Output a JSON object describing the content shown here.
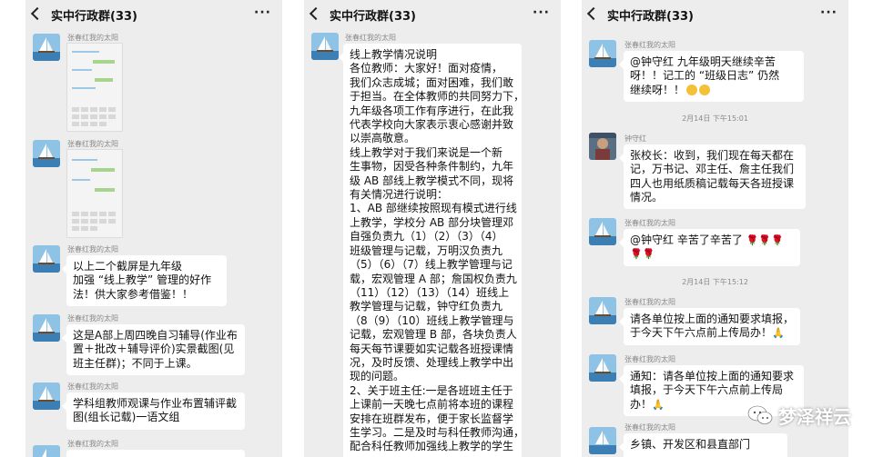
{
  "window_title": "实中行政群(33)",
  "panel1": {
    "senders": [
      "张春红我的太阳",
      "张春红我的太阳",
      "张春红我的太阳",
      "张春红我的太阳",
      "张春红我的太阳",
      "张春红我的太阳"
    ],
    "msg1": [
      "以上二个截屏是九年级",
      "加强 “线上教学” 管理的好作",
      "法！供大家参考借鉴！！"
    ],
    "msg2": [
      "这是A部上周四晚自习辅导(作业布",
      "置＋批改＋辅导评价)实景截图(见",
      "班主任群)；不同于上课。"
    ],
    "msg3": [
      "学科组教师观课与作业布置辅评截",
      "图(组长记载)一语文组"
    ]
  },
  "panel2": {
    "sender": "张春红我的太阳",
    "lines": [
      "线上教学情况说明",
      "   各位教师：大家好！面对疫情，",
      "我们众志成城；面对困难，我们敢",
      "于担当。在全体教师的共同努力下，",
      "九年级各项工作有序进行，在此我",
      "代表学校向大家表示衷心感谢并致",
      "以崇高敬意。",
      "   线上教学对于我们来说是一个新",
      "生事物，因受各种条件制约，九年",
      "级 AB 部线上教学模式不同，现将",
      "有关情况进行说明：",
      "1、AB 部继续按照现有模式进行线",
      "上教学，学校分 AB 部分块管理邓",
      "自强负责九（1）（2）（3）（4）",
      "班级管理与记载，万明汉负责九",
      "（5）（6）（7）线上教学管理与记",
      "载，宏观管理 A 部；詹国权负责九",
      "（11）（12）（13）（14）班线上",
      "教学管理与记载，钟守红负责九",
      "（8（9）（10）班线上教学管理与",
      "记载，宏观管理 B 部，各块负责人",
      "每天每节课要如实记载各班授课情",
      "况，及时反馈、处理线上教学中出",
      "现的问题。",
      "2、关于班主任:一是各班班主任于",
      "上课前一天晚七点前将本班的课程",
      "安排在班群发布，便于家长监督学",
      "生学习。二是及时与科任教师沟通，",
      "配合科任教师加强线上教学的学生"
    ]
  },
  "panel3": {
    "sender_a": "张春红我的太阳",
    "msg_a": [
      "@钟守红  九年级明天继续辛苦",
      "呀！！记工的 “班级日志” 仍然",
      "继续呀！！"
    ],
    "time1": "2月14日 下午15:01",
    "sender_b": "钟守红",
    "msg_b": [
      "张校长：收到，我们现在每天都在",
      "记，万书记、邓主任、詹主任我们",
      "四人也用纸质稿记载每天各班授课",
      "情况。"
    ],
    "sender_c": "张春红我的太阳",
    "msg_c": [
      "@钟守红  辛苦了辛苦了"
    ],
    "time2": "2月14日 下午15:12",
    "sender_d": "张春红我的太阳",
    "msg_d": [
      "请各单位按上面的通知要求填报，",
      "于今天下午六点前上传局办！"
    ],
    "sender_e": "张春红我的太阳",
    "msg_e": [
      "通知：请各单位按上面的通知要求",
      "填报，于今天下午六点前上传局",
      "办！"
    ],
    "sender_f": "张春红我的太阳",
    "msg_f": [
      "乡镇、开发区和县直部门"
    ]
  },
  "watermark": "梦泽祥云",
  "colors": {
    "chat_bg": "#ededed",
    "bubble": "#ffffff",
    "name": "#8a8a8a",
    "rose": "#d83a3a"
  },
  "icons": [
    "back-arrow-icon",
    "more-icon",
    "avatar-sailboat",
    "avatar-photo",
    "smile-emoji",
    "rose-emoji",
    "hand-emoji",
    "wechat-logo-icon"
  ]
}
